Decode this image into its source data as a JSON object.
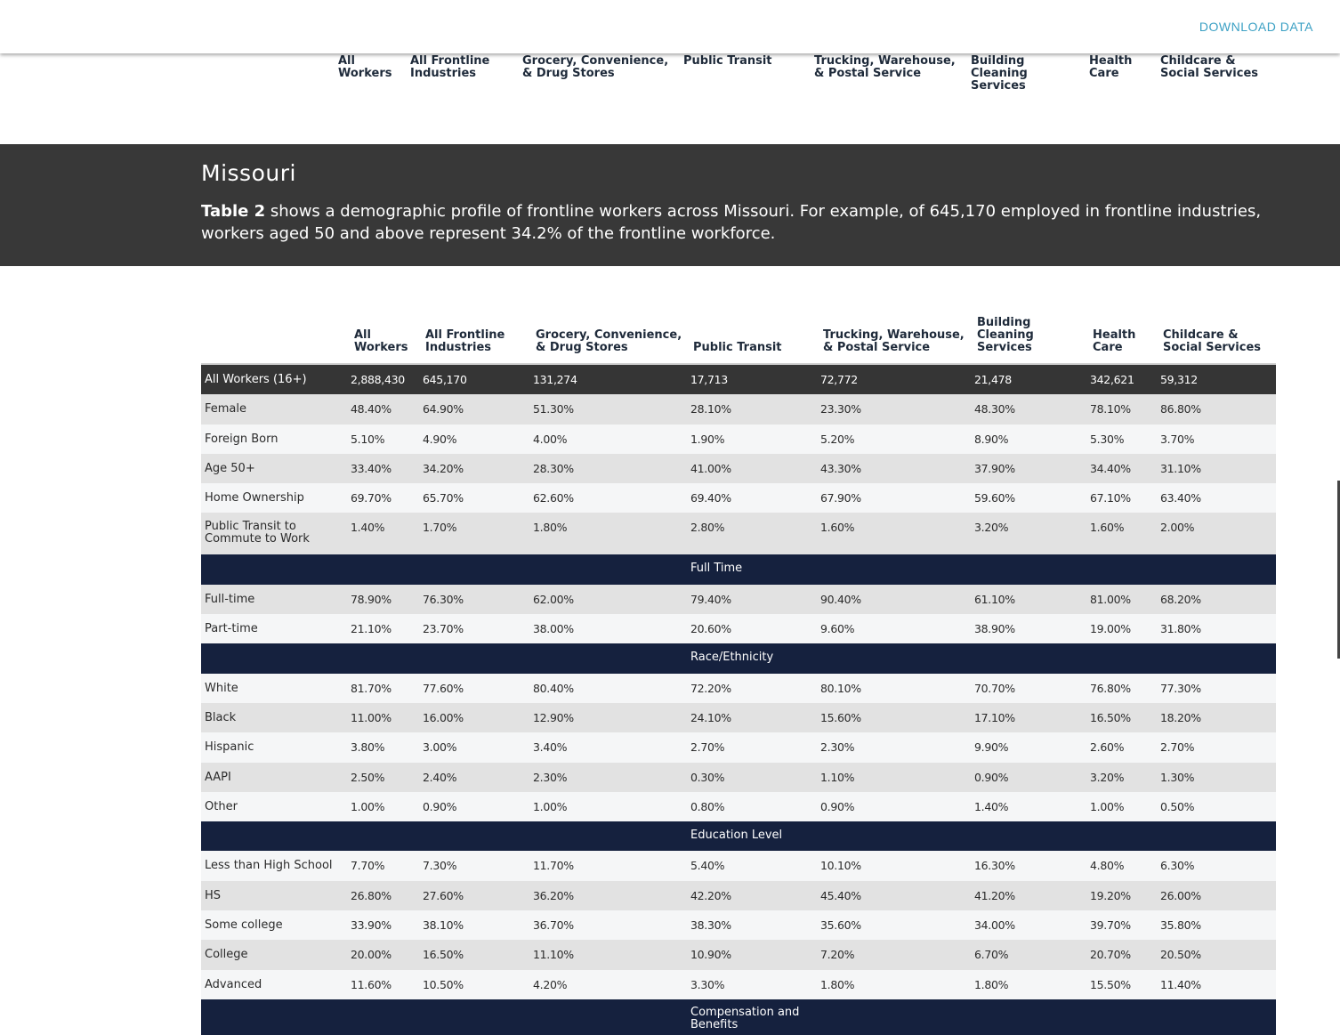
{
  "topbar": {
    "download_label": "DOWNLOAD DATA"
  },
  "columns": [
    "All\nWorkers",
    "All Frontline\nIndustries",
    "Grocery, Convenience,\n& Drug Stores",
    "Public Transit",
    "Trucking, Warehouse,\n& Postal Service",
    "Building\nCleaning\nServices",
    "Health\nCare",
    "Childcare &\nSocial Services"
  ],
  "banner": {
    "title": "Missouri",
    "desc_bold": "Table 2",
    "desc_rest": " shows a demographic profile of frontline workers across Missouri. For example, of 645,170 employed in frontline industries, workers aged 50 and above represent 34.2% of the frontline workforce."
  },
  "rows": [
    {
      "type": "dark",
      "label": "All Workers (16+)",
      "values": [
        "2,888,430",
        "645,170",
        "131,274",
        "17,713",
        "72,772",
        "21,478",
        "342,621",
        "59,312"
      ]
    },
    {
      "type": "gray",
      "label": "Female",
      "values": [
        "48.40%",
        "64.90%",
        "51.30%",
        "28.10%",
        "23.30%",
        "48.30%",
        "78.10%",
        "86.80%"
      ]
    },
    {
      "type": "light",
      "label": "Foreign Born",
      "values": [
        "5.10%",
        "4.90%",
        "4.00%",
        "1.90%",
        "5.20%",
        "8.90%",
        "5.30%",
        "3.70%"
      ]
    },
    {
      "type": "gray",
      "label": "Age 50+",
      "values": [
        "33.40%",
        "34.20%",
        "28.30%",
        "41.00%",
        "43.30%",
        "37.90%",
        "34.40%",
        "31.10%"
      ]
    },
    {
      "type": "light",
      "label": "Home Ownership",
      "values": [
        "69.70%",
        "65.70%",
        "62.60%",
        "69.40%",
        "67.90%",
        "59.60%",
        "67.10%",
        "63.40%"
      ]
    },
    {
      "type": "gray tall",
      "label": "Public Transit to Commute to Work",
      "values": [
        "1.40%",
        "1.70%",
        "1.80%",
        "2.80%",
        "1.60%",
        "3.20%",
        "1.60%",
        "2.00%"
      ]
    },
    {
      "type": "section",
      "label": "Full Time"
    },
    {
      "type": "gray",
      "label": "Full-time",
      "values": [
        "78.90%",
        "76.30%",
        "62.00%",
        "79.40%",
        "90.40%",
        "61.10%",
        "81.00%",
        "68.20%"
      ]
    },
    {
      "type": "light",
      "label": "Part-time",
      "values": [
        "21.10%",
        "23.70%",
        "38.00%",
        "20.60%",
        "9.60%",
        "38.90%",
        "19.00%",
        "31.80%"
      ]
    },
    {
      "type": "section",
      "label": "Race/Ethnicity"
    },
    {
      "type": "light",
      "label": "White",
      "values": [
        "81.70%",
        "77.60%",
        "80.40%",
        "72.20%",
        "80.10%",
        "70.70%",
        "76.80%",
        "77.30%"
      ]
    },
    {
      "type": "gray",
      "label": "Black",
      "values": [
        "11.00%",
        "16.00%",
        "12.90%",
        "24.10%",
        "15.60%",
        "17.10%",
        "16.50%",
        "18.20%"
      ]
    },
    {
      "type": "light",
      "label": "Hispanic",
      "values": [
        "3.80%",
        "3.00%",
        "3.40%",
        "2.70%",
        "2.30%",
        "9.90%",
        "2.60%",
        "2.70%"
      ]
    },
    {
      "type": "gray",
      "label": "AAPI",
      "values": [
        "2.50%",
        "2.40%",
        "2.30%",
        "0.30%",
        "1.10%",
        "0.90%",
        "3.20%",
        "1.30%"
      ]
    },
    {
      "type": "light",
      "label": "Other",
      "values": [
        "1.00%",
        "0.90%",
        "1.00%",
        "0.80%",
        "0.90%",
        "1.40%",
        "1.00%",
        "0.50%"
      ]
    },
    {
      "type": "section",
      "label": "Education Level"
    },
    {
      "type": "light",
      "label": "Less than High School",
      "values": [
        "7.70%",
        "7.30%",
        "11.70%",
        "5.40%",
        "10.10%",
        "16.30%",
        "4.80%",
        "6.30%"
      ]
    },
    {
      "type": "gray",
      "label": "HS",
      "values": [
        "26.80%",
        "27.60%",
        "36.20%",
        "42.20%",
        "45.40%",
        "41.20%",
        "19.20%",
        "26.00%"
      ]
    },
    {
      "type": "light",
      "label": "Some college",
      "values": [
        "33.90%",
        "38.10%",
        "36.70%",
        "38.30%",
        "35.60%",
        "34.00%",
        "39.70%",
        "35.80%"
      ]
    },
    {
      "type": "gray",
      "label": "College",
      "values": [
        "20.00%",
        "16.50%",
        "11.10%",
        "10.90%",
        "7.20%",
        "6.70%",
        "20.70%",
        "20.50%"
      ]
    },
    {
      "type": "light",
      "label": "Advanced",
      "values": [
        "11.60%",
        "10.50%",
        "4.20%",
        "3.30%",
        "1.80%",
        "1.80%",
        "15.50%",
        "11.40%"
      ]
    },
    {
      "type": "section tall",
      "label": "Compensation and Benefits"
    }
  ]
}
